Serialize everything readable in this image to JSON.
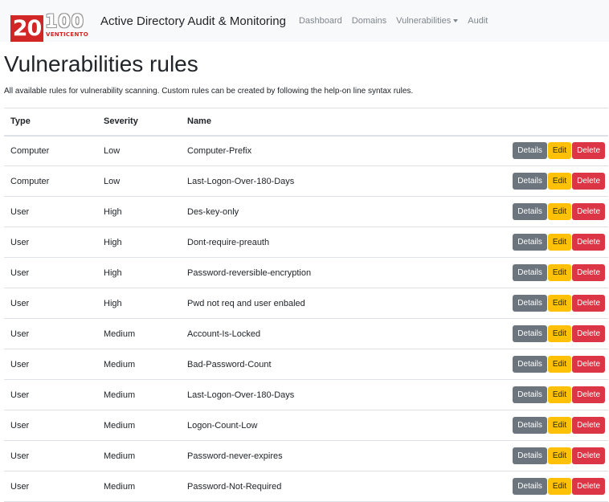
{
  "navbar": {
    "logo": {
      "number_left": "20",
      "number_right": "100",
      "subtext": "VENTICENTO"
    },
    "title": "Active Directory Audit & Monitoring",
    "links": [
      "Dashboard",
      "Domains",
      "Vulnerabilities",
      "Audit"
    ]
  },
  "page": {
    "heading": "Vulnerabilities rules",
    "description": "All available rules for vulnerability scanning. Custom rules can be created by following the help-on line syntax rules."
  },
  "table": {
    "headers": {
      "type": "Type",
      "severity": "Severity",
      "name": "Name"
    },
    "rows": [
      {
        "type": "Computer",
        "severity": "Low",
        "name": "Computer-Prefix"
      },
      {
        "type": "Computer",
        "severity": "Low",
        "name": "Last-Logon-Over-180-Days"
      },
      {
        "type": "User",
        "severity": "High",
        "name": "Des-key-only"
      },
      {
        "type": "User",
        "severity": "High",
        "name": "Dont-require-preauth"
      },
      {
        "type": "User",
        "severity": "High",
        "name": "Password-reversible-encryption"
      },
      {
        "type": "User",
        "severity": "High",
        "name": "Pwd not req and user enbaled"
      },
      {
        "type": "User",
        "severity": "Medium",
        "name": "Account-Is-Locked"
      },
      {
        "type": "User",
        "severity": "Medium",
        "name": "Bad-Password-Count"
      },
      {
        "type": "User",
        "severity": "Medium",
        "name": "Last-Logon-Over-180-Days"
      },
      {
        "type": "User",
        "severity": "Medium",
        "name": "Logon-Count-Low"
      },
      {
        "type": "User",
        "severity": "Medium",
        "name": "Password-never-expires"
      },
      {
        "type": "User",
        "severity": "Medium",
        "name": "Password-Not-Required"
      }
    ],
    "actions": {
      "details": "Details",
      "edit": "Edit",
      "delete": "Delete"
    }
  },
  "colors": {
    "navbar_bg": "#f8f9fa",
    "logo_red": "#d22525",
    "details_btn": "#6c757d",
    "edit_btn": "#ffc107",
    "delete_btn": "#dc3545"
  },
  "icons": {
    "nav_dropdown": "caret-down-icon"
  }
}
